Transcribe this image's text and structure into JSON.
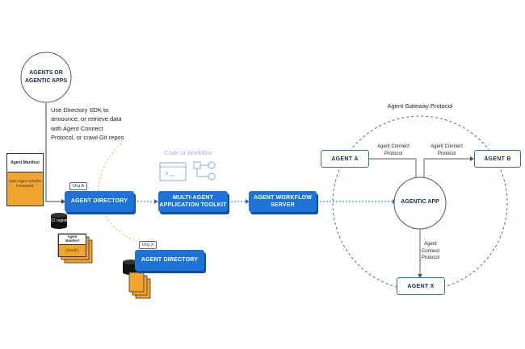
{
  "agents_circle": {
    "label": "AGENTS OR AGENTIC APPS"
  },
  "sdk_note": "Use Directory SDK to announce, or retrieve data with Agent Connect Protocol, or crawl Git repos",
  "manifest_doc": {
    "title": "Agent Manifest",
    "subtitle": "Open Agent Schema Framework"
  },
  "org_a": {
    "tag": "Org A",
    "label": "AGENT DIRECTORY"
  },
  "org_x": {
    "tag": "Org X",
    "label": "AGENT DIRECTORY"
  },
  "oci_registry": "OCI registry",
  "stack_doc": {
    "title": "Agent Manifest",
    "subtitle": "[OASF]"
  },
  "code_or_workflow": "Code or Workflow",
  "toolkit": {
    "label": "MULTI-AGENT APPLICATION TOOLKIT"
  },
  "workflow_server": {
    "label": "AGENT WORKFLOW SERVER"
  },
  "gateway": {
    "title": "Agent Gateway Protocol",
    "agent_a": "AGENT A",
    "agent_b": "AGENT B",
    "agent_x": "AGENT X",
    "center": "AGENTIC APP",
    "acp_label": "Agent Connect Protocol"
  },
  "colors": {
    "blue": "#1d73d6",
    "dashed": "#2f6fb8",
    "orange": "#f2a52e",
    "dotted_yellow": "#d9c44a"
  }
}
